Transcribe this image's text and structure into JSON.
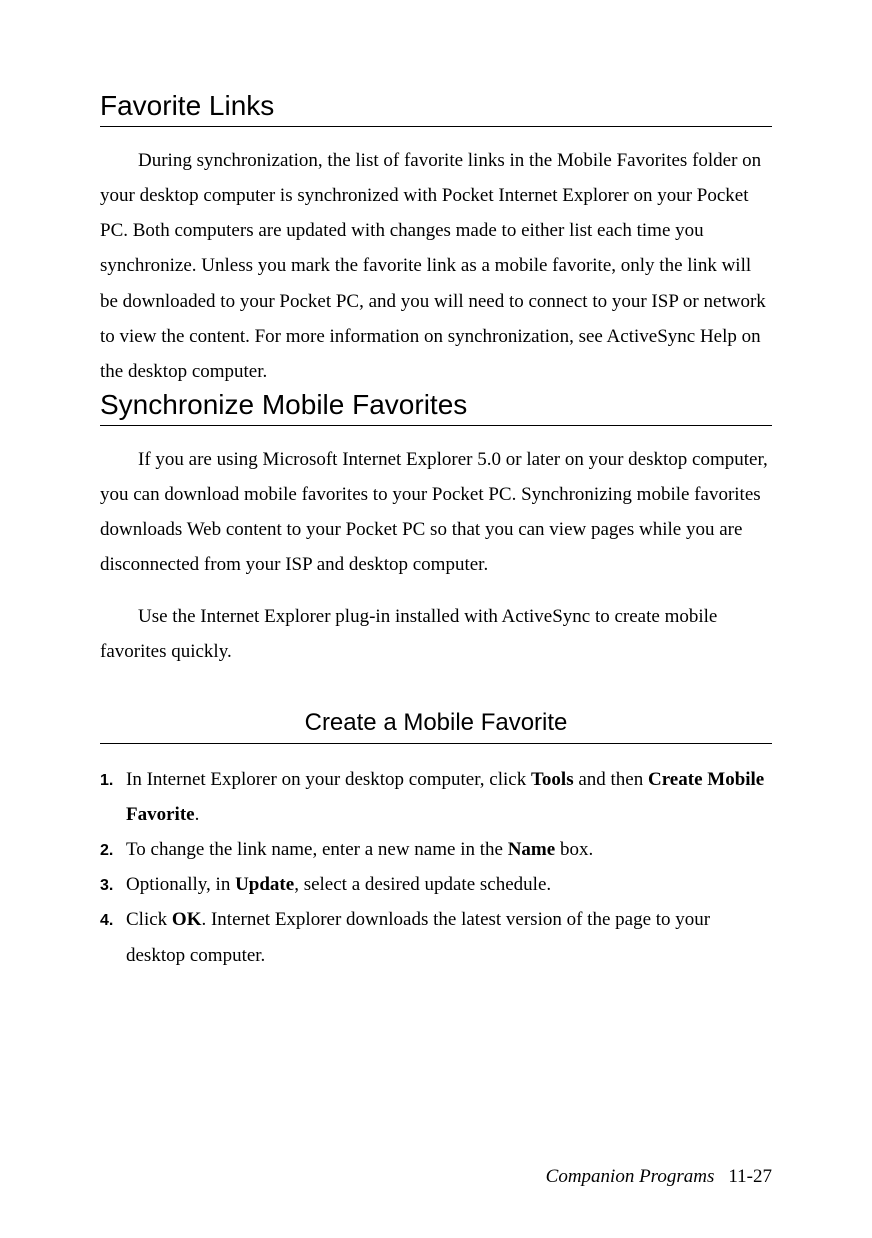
{
  "sections": {
    "favorite_links": {
      "heading": "Favorite Links",
      "para1": "During synchronization, the list of favorite links in the Mobile Favorites folder on your desktop computer is synchronized with Pocket Internet Explorer on your Pocket PC. Both computers are updated with changes made to either list each time you synchronize. Unless you mark the favorite link as a mobile favorite, only the link will be downloaded to your Pocket PC, and you will need to connect to your ISP or network to view the content. For more information on synchronization, see ActiveSync Help on the desktop computer."
    },
    "sync_mobile": {
      "heading": "Synchronize Mobile Favorites",
      "para1": "If you are using Microsoft Internet Explorer 5.0 or later on your desktop computer, you can download mobile favorites to your Pocket PC. Synchronizing mobile favorites downloads Web content to your Pocket PC so that you can view pages while you are disconnected from your ISP and desktop computer.",
      "para2": "Use the Internet Explorer plug-in installed with ActiveSync to create mobile favorites quickly."
    },
    "create": {
      "heading": "Create a Mobile Favorite",
      "steps": {
        "s1a": "In Internet Explorer on your desktop computer, click ",
        "s1b": "Tools",
        "s1c": " and then ",
        "s1d": "Create Mobile Favorite",
        "s1e": ".",
        "s2a": "To change the link name, enter a new name in the ",
        "s2b": "Name",
        "s2c": " box.",
        "s3a": "Optionally, in ",
        "s3b": "Update",
        "s3c": ", select a desired update schedule.",
        "s4a": "Click ",
        "s4b": "OK",
        "s4c": ". Internet Explorer downloads the latest version of the page to your desktop computer."
      }
    }
  },
  "footer": {
    "title": "Companion Programs",
    "page": "11-27"
  }
}
